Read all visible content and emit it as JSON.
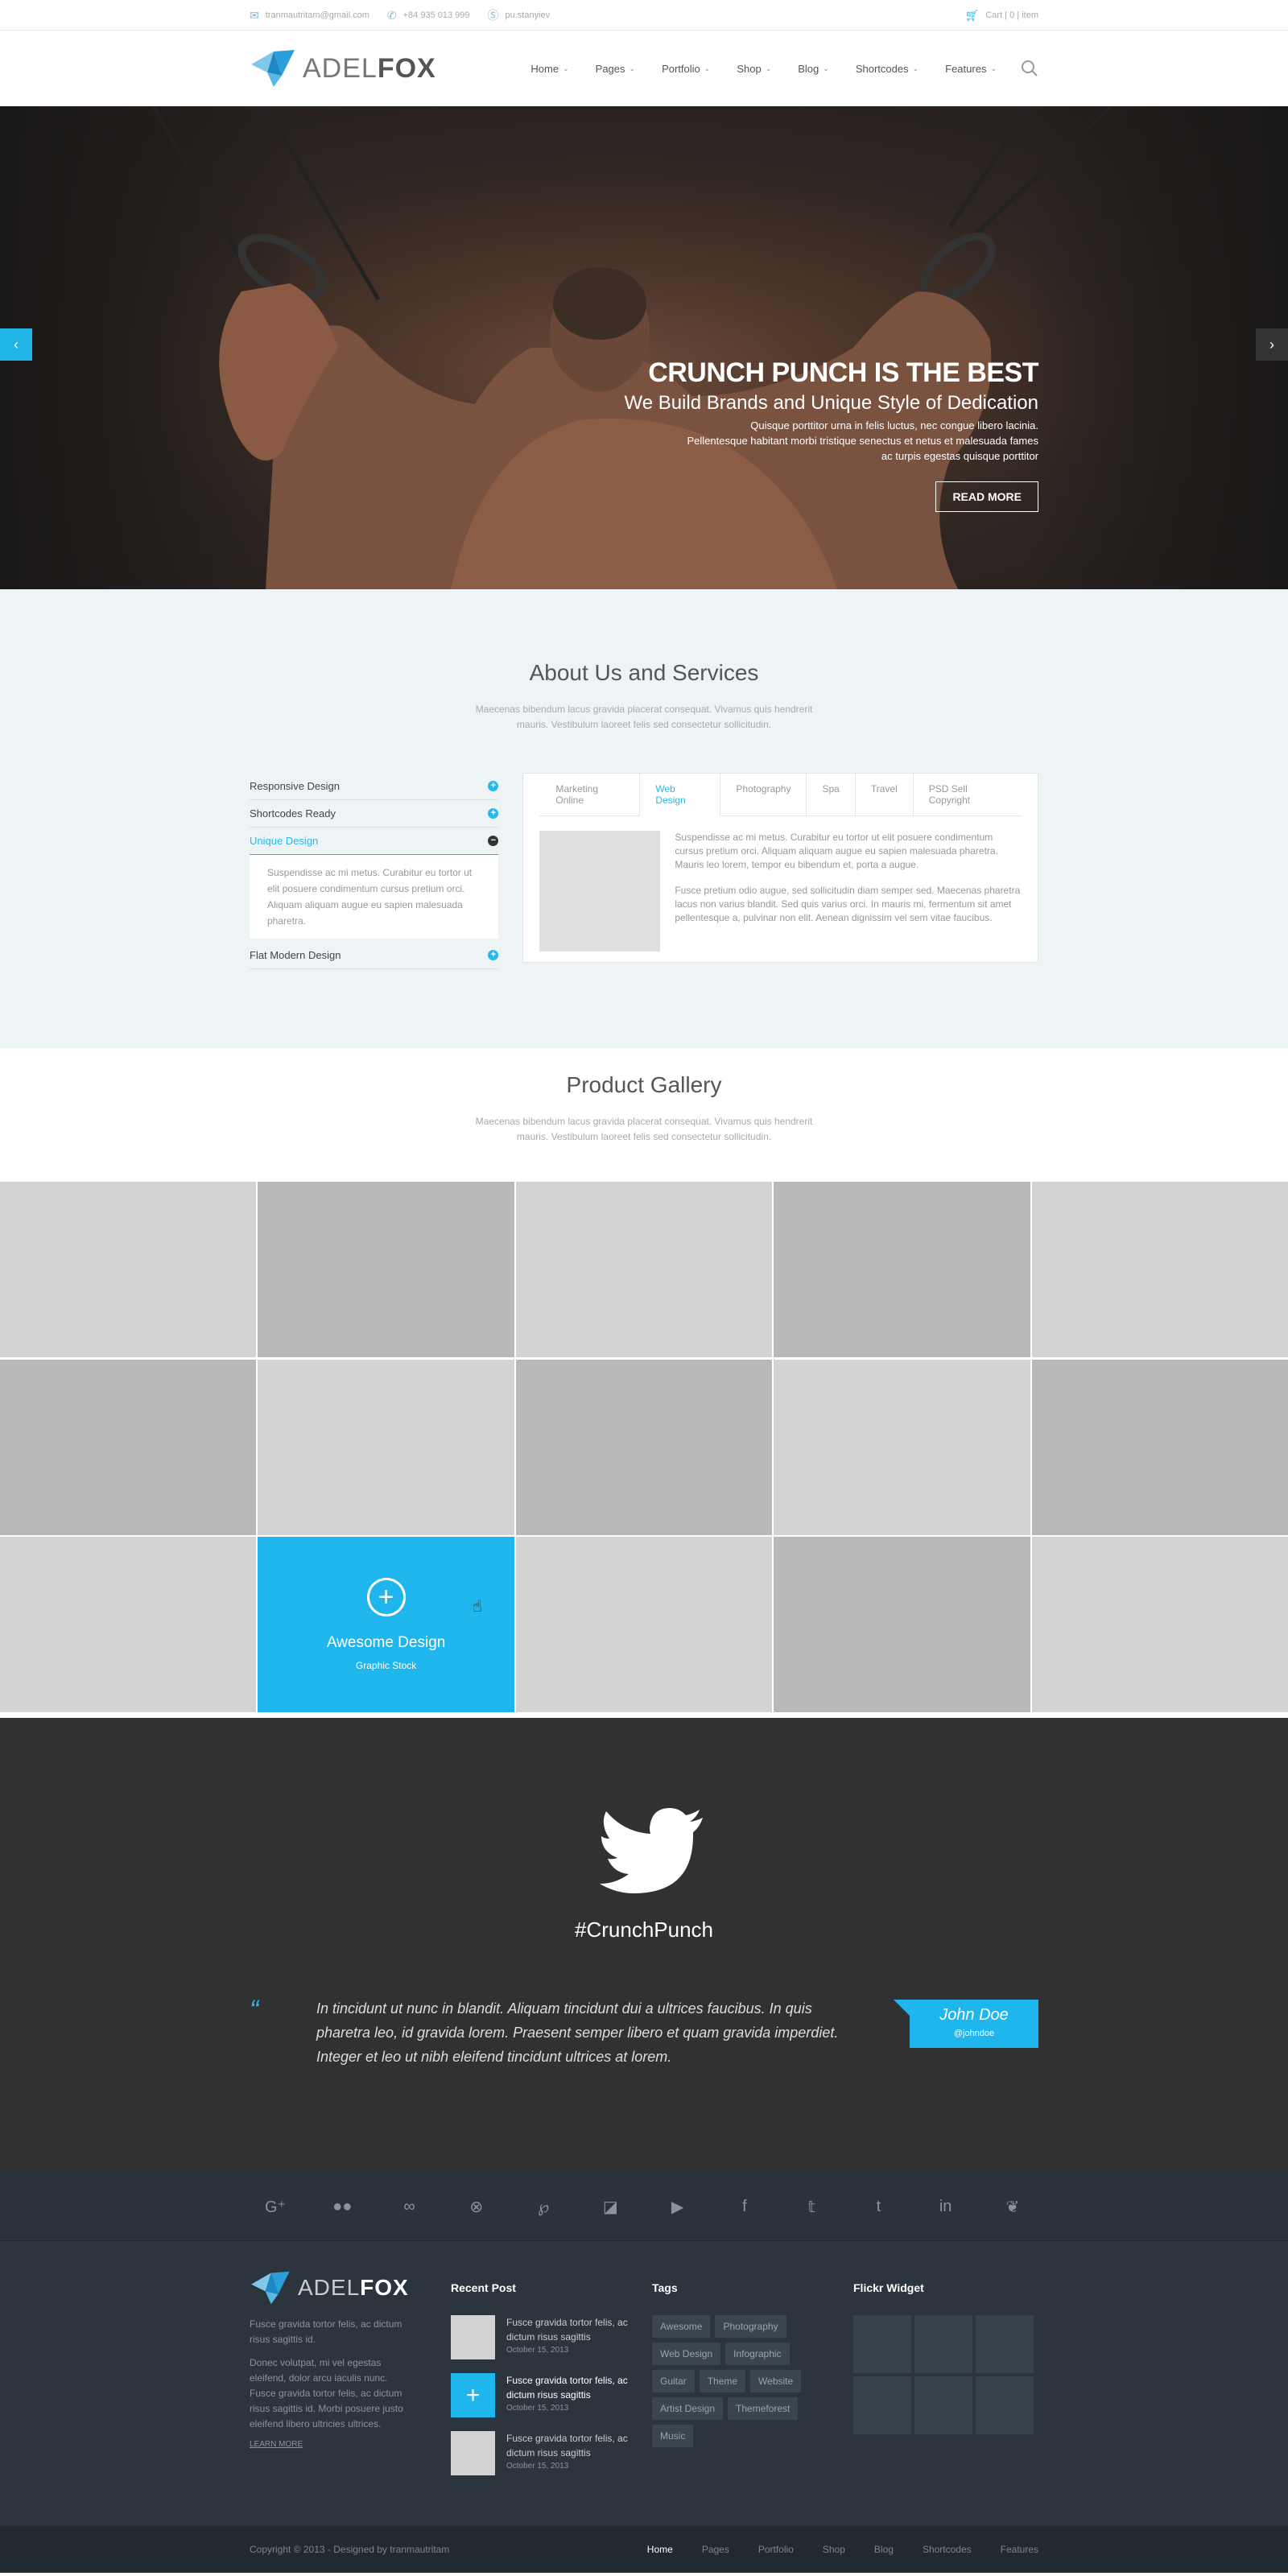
{
  "topbar": {
    "email": "tranmautritam@gmail.com",
    "phone": "+84 935 013 999",
    "skype": "pu.stanyiev",
    "cart": "Cart",
    "cart_count": "0",
    "cart_items": "item"
  },
  "header": {
    "logo_light": "ADEL",
    "logo_bold": "FOX",
    "nav": [
      {
        "label": "Home"
      },
      {
        "label": "Pages"
      },
      {
        "label": "Portfolio"
      },
      {
        "label": "Shop"
      },
      {
        "label": "Blog"
      },
      {
        "label": "Shortcodes"
      },
      {
        "label": "Features"
      }
    ]
  },
  "hero": {
    "title": "CRUNCH PUNCH IS THE BEST",
    "subtitle": "We Build Brands and Unique Style of Dedication",
    "text_1": "Quisque porttitor urna in felis luctus, nec congue libero lacinia.",
    "text_2": "Pellentesque habitant morbi tristique senectus et netus et malesuada fames",
    "text_3": "ac turpis egestas quisque porttitor",
    "button": "READ MORE"
  },
  "about": {
    "title": "About Us and Services",
    "subtitle": "Maecenas bibendum lacus gravida placerat consequat. Vivamus quis hendrerit mauris. Vestibulum laoreet felis sed consectetur sollicitudin.",
    "accordion": [
      {
        "label": "Responsive Design",
        "icon": "+"
      },
      {
        "label": "Shortcodes Ready",
        "icon": "+"
      },
      {
        "label": "Unique Design",
        "icon": "−"
      },
      {
        "label": "Flat Modern Design",
        "icon": "+"
      }
    ],
    "accordion_panel": "Suspendisse ac mi metus. Curabitur eu tortor ut elit posuere condimentum cursus pretium orci. Aliquam aliquam augue eu sapien malesuada pharetra.",
    "tabs": [
      "Marketing Online",
      "Web Design",
      "Photography",
      "Spa",
      "Travel",
      "PSD Sell Copyright"
    ],
    "tab_p1": "Suspendisse ac mi metus. Curabitur eu tortor ut elit posuere condimentum cursus pretium orci. Aliquam aliquam augue eu sapien malesuada pharetra. Mauris leo lorem, tempor eu bibendum et, porta a augue.",
    "tab_p2": "Fusce pretium odio augue, sed sollicitudin diam semper sed. Maecenas pharetra lacus non varius blandit. Sed quis varius orci. In mauris mi, fermentum sit amet pellentesque a, pulvinar non elit. Aenean dignissim vel sem vitae faucibus."
  },
  "gallery": {
    "title": "Product Gallery",
    "subtitle": "Maecenas bibendum lacus gravida placerat consequat. Vivamus quis hendrerit mauris. Vestibulum laoreet felis sed consectetur sollicitudin.",
    "hover_title": "Awesome Design",
    "hover_sub": "Graphic Stock"
  },
  "twitter": {
    "hashtag": "#CrunchPunch",
    "quote": "In tincidunt ut nunc in blandit. Aliquam tincidunt dui a ultrices faucibus. In quis pharetra leo, id gravida lorem. Praesent semper libero et quam gravida imperdiet. Integer et leo ut nibh eleifend tincidunt ultrices at lorem.",
    "author": "John Doe",
    "handle": "@johndoe"
  },
  "social_icons": [
    "google-plus-icon",
    "flickr-icon",
    "lastfm-icon",
    "dribbble-icon",
    "pinterest-icon",
    "delicious-icon",
    "youtube-icon",
    "facebook-icon",
    "twitter-icon",
    "tumblr-icon",
    "linkedin-icon",
    "vine-icon"
  ],
  "footer": {
    "about_1": "Fusce gravida tortor felis, ac dictum risus sagittis id.",
    "about_2": "Donec volutpat, mi vel egestas eleifend, dolor arcu iaculis nunc. Fusce gravida tortor felis, ac dictum risus sagittis id. Morbi posuere justo eleifend libero ultricies ultrices.",
    "learn_more": "LEARN MORE",
    "recent_title": "Recent Post",
    "posts": [
      {
        "title": "Fusce gravida tortor felis, ac dictum risus sagittis",
        "date": "October 15, 2013"
      },
      {
        "title": "Fusce gravida tortor felis, ac dictum risus sagittis",
        "date": "October 15, 2013"
      },
      {
        "title": "Fusce gravida tortor felis, ac dictum risus sagittis",
        "date": "October 15, 2013"
      }
    ],
    "tags_title": "Tags",
    "tags": [
      "Awesome",
      "Photography",
      "Web Design",
      "Infographic",
      "Guitar",
      "Theme",
      "Website",
      "Artist Design",
      "Themeforest",
      "Music"
    ],
    "flickr_title": "Flickr Widget"
  },
  "bottom": {
    "copyright": "Copyright © 2013 - Designed by tranmautritam",
    "nav": [
      "Home",
      "Pages",
      "Portfolio",
      "Shop",
      "Blog",
      "Shortcodes",
      "Features"
    ]
  },
  "colors": {
    "accent": "#1fb6ee",
    "dark": "#313131",
    "footer": "#2c353e"
  }
}
